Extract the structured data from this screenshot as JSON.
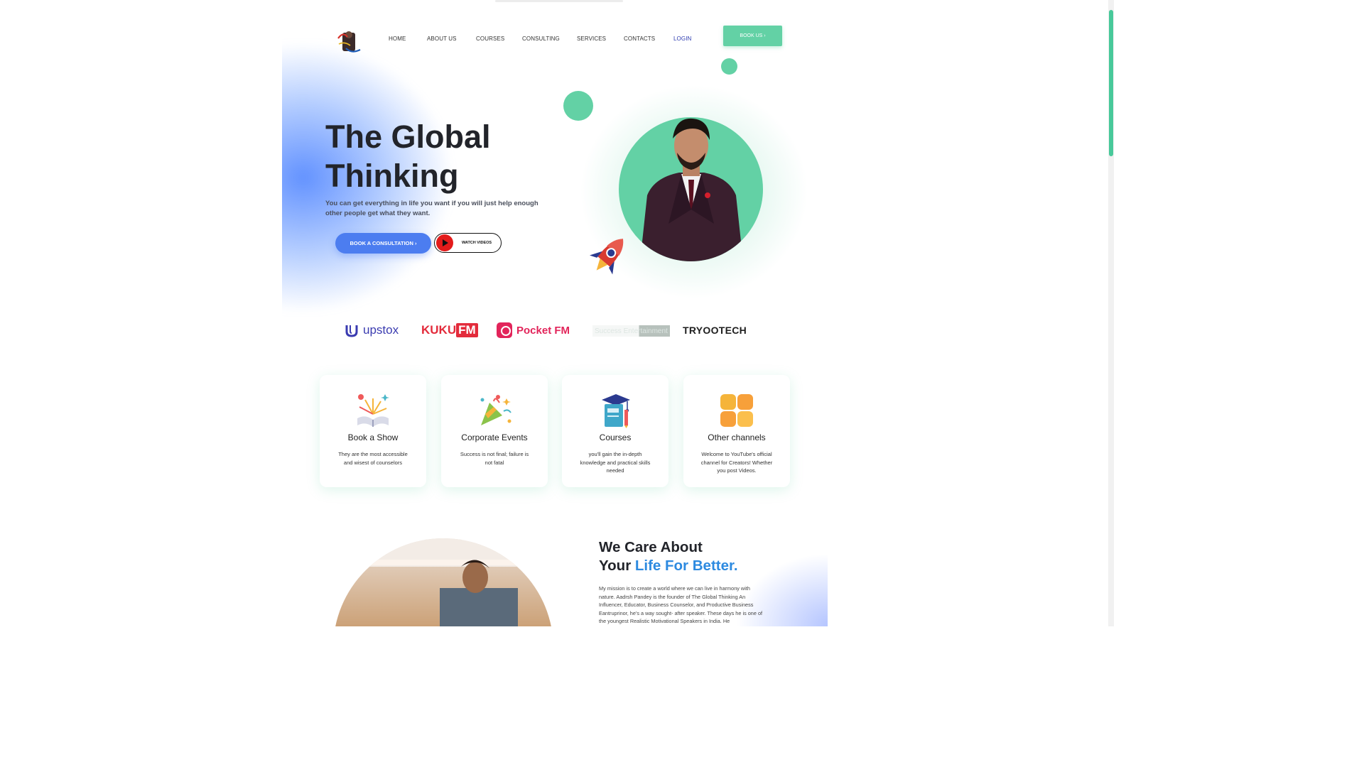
{
  "nav": {
    "items": [
      {
        "label": "HOME"
      },
      {
        "label": "ABOUT US"
      },
      {
        "label": "COURSES"
      },
      {
        "label": "CONSULTING"
      },
      {
        "label": "SERVICES"
      },
      {
        "label": "CONTACTS"
      },
      {
        "label": "LOGIN"
      }
    ],
    "book_us": "BOOK US ›"
  },
  "hero": {
    "title_line1": "The Global",
    "title_line2": "Thinking",
    "subtitle": "You can get everything in life you want if you will just help enough other people get what they want.",
    "consult_button": "BOOK A CONSULTATION ›",
    "watch_button": "WATCH VIDEOS"
  },
  "partners": {
    "upstox": "upstox",
    "kuku_a": "KUKU",
    "kuku_b": "FM",
    "pocket": "Pocket FM",
    "success": "Success Entertainment",
    "tryoo": "TRYOOTECH"
  },
  "cards": [
    {
      "title": "Book a Show",
      "desc": "They are the most accessible and wisest of counselors"
    },
    {
      "title": "Corporate Events",
      "desc": "Success is not final; failure is not fatal"
    },
    {
      "title": "Courses",
      "desc": "you'll gain the in-depth knowledge and practical skills needed"
    },
    {
      "title": "Other channels",
      "desc": "Welcome to YouTube's official channel for Creators! Whether you post Videos."
    }
  ],
  "about": {
    "title_line1": "We Care About",
    "title_line2_a": "Your ",
    "title_line2_b": "Life For Better.",
    "mission": "My mission is to create a world where we can live in harmony with nature. Aadrsh Pandey is the founder of The Global Thinking An Influencer, Educator, Business Counselor, and Productive Business Eantruprinor, he's a way sought- after speaker. These days he is one of the youngest Realistic Motivational Speakers in India. He"
  },
  "colors": {
    "accent_green": "#63d1a5",
    "accent_blue": "#4c7df0",
    "heading_blue": "#2d8ae0"
  }
}
